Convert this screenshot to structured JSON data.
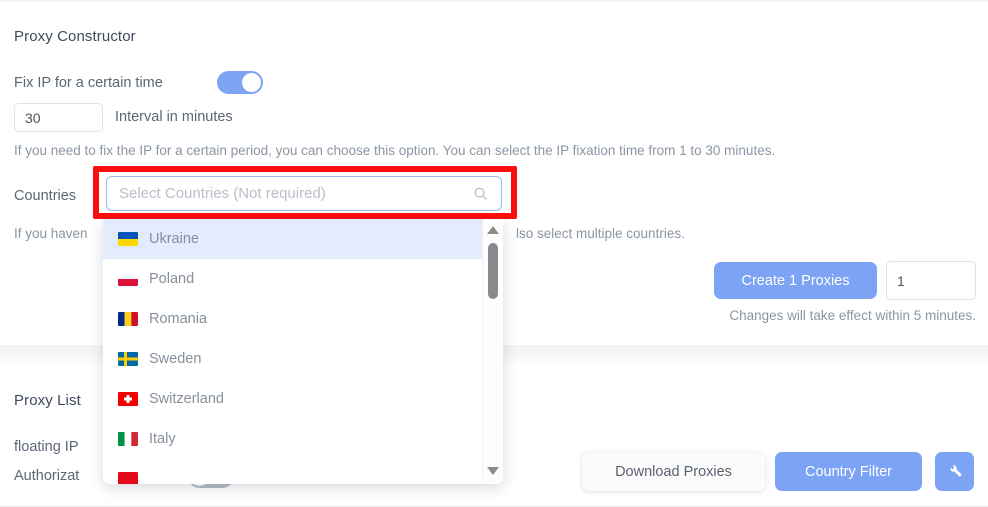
{
  "constructor_section": {
    "title": "Proxy Constructor",
    "fix_ip": {
      "label": "Fix IP for a certain time",
      "toggle_state": "on"
    },
    "interval": {
      "value": "30",
      "label": "Interval in minutes"
    },
    "fix_ip_hint": "If you need to fix the IP for a certain period, you can choose this option. You can select the IP fixation time from 1 to 30 minutes.",
    "countries": {
      "label": "Countries",
      "placeholder": "Select Countries (Not required)",
      "value": "",
      "search_icon": "search-icon",
      "hint_left": "If you haven",
      "hint_right": "lso select multiple countries."
    },
    "create": {
      "button_label": "Create 1 Proxies",
      "quantity": "1",
      "note": "Changes will take effect within 5 minutes."
    }
  },
  "country_dropdown": {
    "scrollbar": {
      "up_arrow": "triangle-up-icon",
      "down_arrow": "triangle-down-icon"
    },
    "items": [
      {
        "name": "Ukraine",
        "code": "UA",
        "selected": true,
        "flag": "flag-ua-icon"
      },
      {
        "name": "Poland",
        "code": "PL",
        "selected": false,
        "flag": "flag-pl-icon"
      },
      {
        "name": "Romania",
        "code": "RO",
        "selected": false,
        "flag": "flag-ro-icon"
      },
      {
        "name": "Sweden",
        "code": "SE",
        "selected": false,
        "flag": "flag-se-icon"
      },
      {
        "name": "Switzerland",
        "code": "CH",
        "selected": false,
        "flag": "flag-ch-icon"
      },
      {
        "name": "Italy",
        "code": "IT",
        "selected": false,
        "flag": "flag-it-icon"
      },
      {
        "name": "",
        "code": "TR",
        "selected": false,
        "flag": "flag-tr-icon"
      }
    ]
  },
  "proxy_list_section": {
    "title": "Proxy List",
    "floating_ip_label": "floating IP",
    "authorization_label": "Authorizat",
    "auth_toggle_state": "off",
    "download_button": "Download Proxies",
    "country_filter_button": "Country Filter",
    "settings_button_icon": "wrench-icon"
  },
  "colors": {
    "accent_blue": "#7da3f5",
    "annotation_red": "#fd0d0d",
    "selected_row": "#e3ecfd",
    "muted_text": "#868f9b"
  }
}
